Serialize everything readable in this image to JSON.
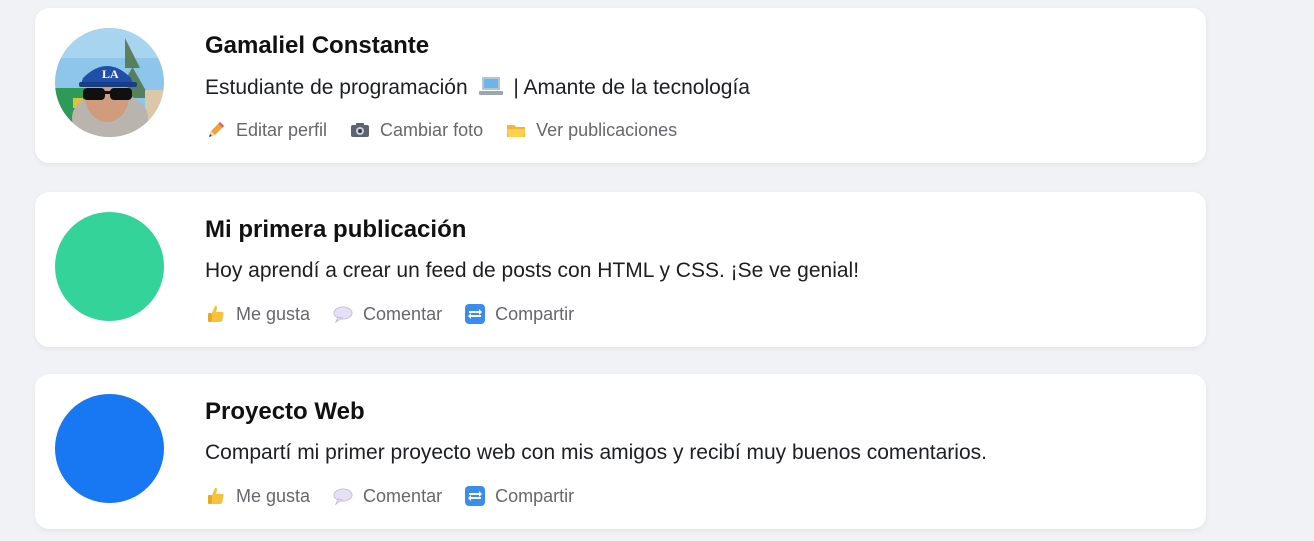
{
  "profile": {
    "name": "Gamaliel Constante",
    "bio_before": "Estudiante de programación",
    "bio_after": "| Amante de la tecnología",
    "bio_icon": "laptop-icon",
    "actions": [
      {
        "label": "Editar perfil",
        "icon": "pencil-icon"
      },
      {
        "label": "Cambiar foto",
        "icon": "camera-icon"
      },
      {
        "label": "Ver publicaciones",
        "icon": "folder-icon"
      }
    ]
  },
  "posts": [
    {
      "title": "Mi primera publicación",
      "text": "Hoy aprendí a crear un feed de posts con HTML y CSS. ¡Se ve genial!",
      "avatar_color": "#34d399",
      "actions": [
        {
          "label": "Me gusta",
          "icon": "thumbs-up-icon"
        },
        {
          "label": "Comentar",
          "icon": "speech-bubble-icon"
        },
        {
          "label": "Compartir",
          "icon": "repeat-icon"
        }
      ]
    },
    {
      "title": "Proyecto Web",
      "text": "Compartí mi primer proyecto web con mis amigos y recibí muy buenos comentarios.",
      "avatar_color": "#1877f2",
      "actions": [
        {
          "label": "Me gusta",
          "icon": "thumbs-up-icon"
        },
        {
          "label": "Comentar",
          "icon": "speech-bubble-icon"
        },
        {
          "label": "Compartir",
          "icon": "repeat-icon"
        }
      ]
    }
  ]
}
